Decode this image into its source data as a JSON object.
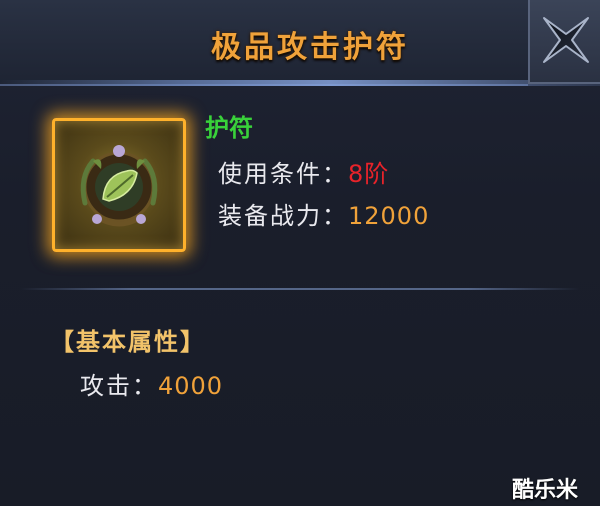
{
  "header": {
    "title": "极品攻击护符"
  },
  "close_icon": "close-x-icon",
  "item": {
    "icon": "leaf-amulet-icon",
    "name": "护符",
    "requirement_label": "使用条件：",
    "requirement_value": "8阶",
    "power_label": "装备战力：",
    "power_value": "12000"
  },
  "attributes": {
    "section_title": "【基本属性】",
    "attack_label": "攻击：",
    "attack_value": "4000"
  },
  "watermark": "酷乐米",
  "colors": {
    "title": "#f0a23a",
    "item_name": "#39d23a",
    "requirement_value": "#e8232a",
    "number_value": "#f0a23a",
    "section_title": "#f2c36a",
    "label": "#e9e9ee"
  }
}
